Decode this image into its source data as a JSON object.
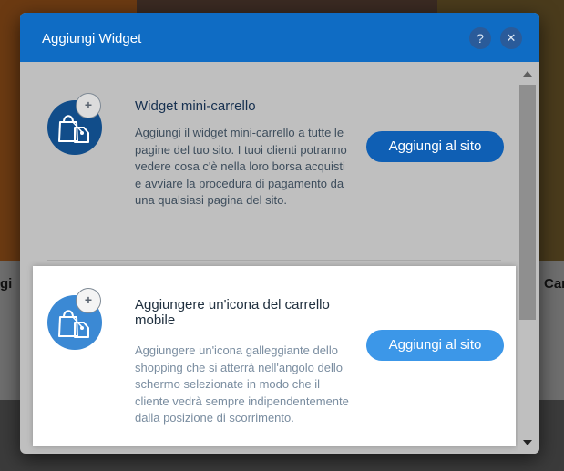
{
  "background": {
    "left_edge_text": "gi",
    "right_edge_text": "Car"
  },
  "dialog": {
    "title": "Aggiungi Widget",
    "help_icon": "question-icon",
    "close_icon": "close-icon",
    "header_color": "#0f6cc4"
  },
  "widgets": [
    {
      "icon": "shopping-bag-icon",
      "badge_icon": "plus-icon",
      "badge": "+",
      "title": "Widget mini-carrello",
      "description": "Aggiungi il widget mini-carrello a tutte le pagine del tuo sito. I tuoi clienti potranno vedere cosa c'è nella loro borsa acquisti e avviare la procedura di pagamento da una qualsiasi pagina del sito.",
      "button_label": "Aggiungi al sito",
      "button_color": "#0f5fb4"
    },
    {
      "icon": "shopping-bag-icon",
      "badge_icon": "plus-icon",
      "badge": "+",
      "title": "Aggiungere un'icona del carrello mobile",
      "description": "Aggiungere un'icona galleggiante dello shopping che si atterrà nell'angolo dello schermo selezionate in modo che il cliente vedrà sempre indipendentemente dalla posizione di scorrimento.",
      "button_label": "Aggiungi al sito",
      "button_color": "#3c97e8"
    }
  ]
}
